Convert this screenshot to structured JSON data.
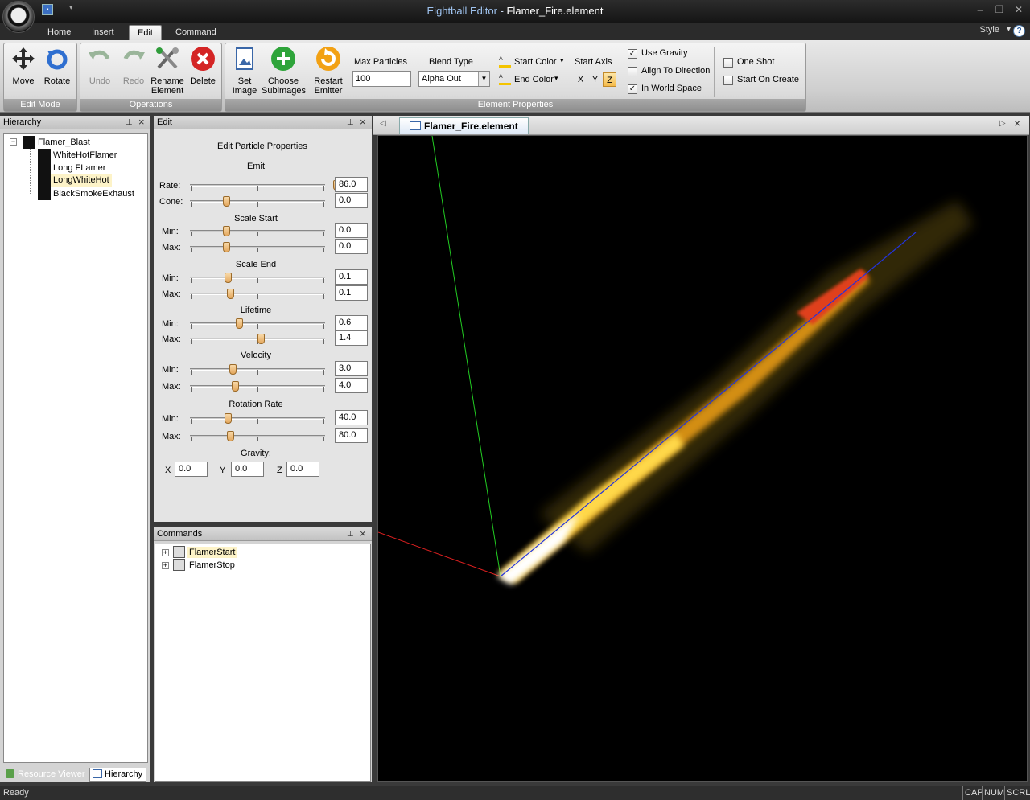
{
  "window": {
    "app_name": "Eightball Editor",
    "separator": " - ",
    "doc_name": "Flamer_Fire.element",
    "minimize": "–",
    "restore": "❐",
    "close": "✕"
  },
  "qat": {
    "more": "▾"
  },
  "ribbon_tabs": [
    {
      "label": "Home"
    },
    {
      "label": "Insert"
    },
    {
      "label": "Edit"
    },
    {
      "label": "Command"
    }
  ],
  "style_menu": {
    "label": "Style",
    "caret": "▾",
    "help": "?"
  },
  "groups": {
    "edit_mode": {
      "label": "Edit Mode",
      "move": "Move",
      "rotate": "Rotate"
    },
    "operations": {
      "label": "Operations",
      "undo": "Undo",
      "redo": "Redo",
      "rename1": "Rename",
      "rename2": "Element",
      "delete": "Delete"
    },
    "element_properties": {
      "label": "Element Properties",
      "set_image1": "Set",
      "set_image2": "Image",
      "choose1": "Choose",
      "choose2": "Subimages",
      "restart1": "Restart",
      "restart2": "Emitter",
      "max_particles_label": "Max Particles",
      "max_particles_value": "100",
      "blend_type_label": "Blend Type",
      "blend_type_value": "Alpha Out",
      "start_color": "Start Color",
      "end_color": "End Color",
      "start_axis_label": "Start Axis",
      "axis_x": "X",
      "axis_y": "Y",
      "axis_z": "Z",
      "use_gravity": "Use Gravity",
      "align_to_direction": "Align To Direction",
      "in_world_space": "In World Space",
      "one_shot": "One Shot",
      "start_on_create": "Start On Create"
    }
  },
  "hierarchy": {
    "title": "Hierarchy",
    "root": "Flamer_Blast",
    "children": [
      "WhiteHotFlamer",
      "Long FLamer",
      "LongWhiteHot",
      "BlackSmokeExhaust"
    ],
    "tab_resource": "Resource Viewer",
    "tab_hierarchy": "Hierarchy"
  },
  "edit": {
    "title": "Edit",
    "heading": "Edit Particle Properties",
    "emit": "Emit",
    "rate": "Rate:",
    "rate_v": "86.0",
    "cone": "Cone:",
    "cone_v": "0.0",
    "scale_start": "Scale Start",
    "ss_min_v": "0.0",
    "ss_max_v": "0.0",
    "scale_end": "Scale End",
    "se_min_v": "0.1",
    "se_max_v": "0.1",
    "lifetime": "Lifetime",
    "lt_min_v": "0.6",
    "lt_max_v": "1.4",
    "velocity": "Velocity",
    "v_min_v": "3.0",
    "v_max_v": "4.0",
    "rotation_rate": "Rotation Rate",
    "rr_min_v": "40.0",
    "rr_max_v": "80.0",
    "min": "Min:",
    "max": "Max:",
    "gravity": "Gravity:",
    "gx": "X",
    "gy": "Y",
    "gz": "Z",
    "gx_v": "0.0",
    "gy_v": "0.0",
    "gz_v": "0.0"
  },
  "commands": {
    "title": "Commands",
    "items": [
      "FlamerStart",
      "FlamerStop"
    ]
  },
  "document_tab": {
    "label": "Flamer_Fire.element"
  },
  "status": {
    "text": "Ready",
    "cap": "CAP",
    "num": "NUM",
    "scrl": "SCRL"
  }
}
